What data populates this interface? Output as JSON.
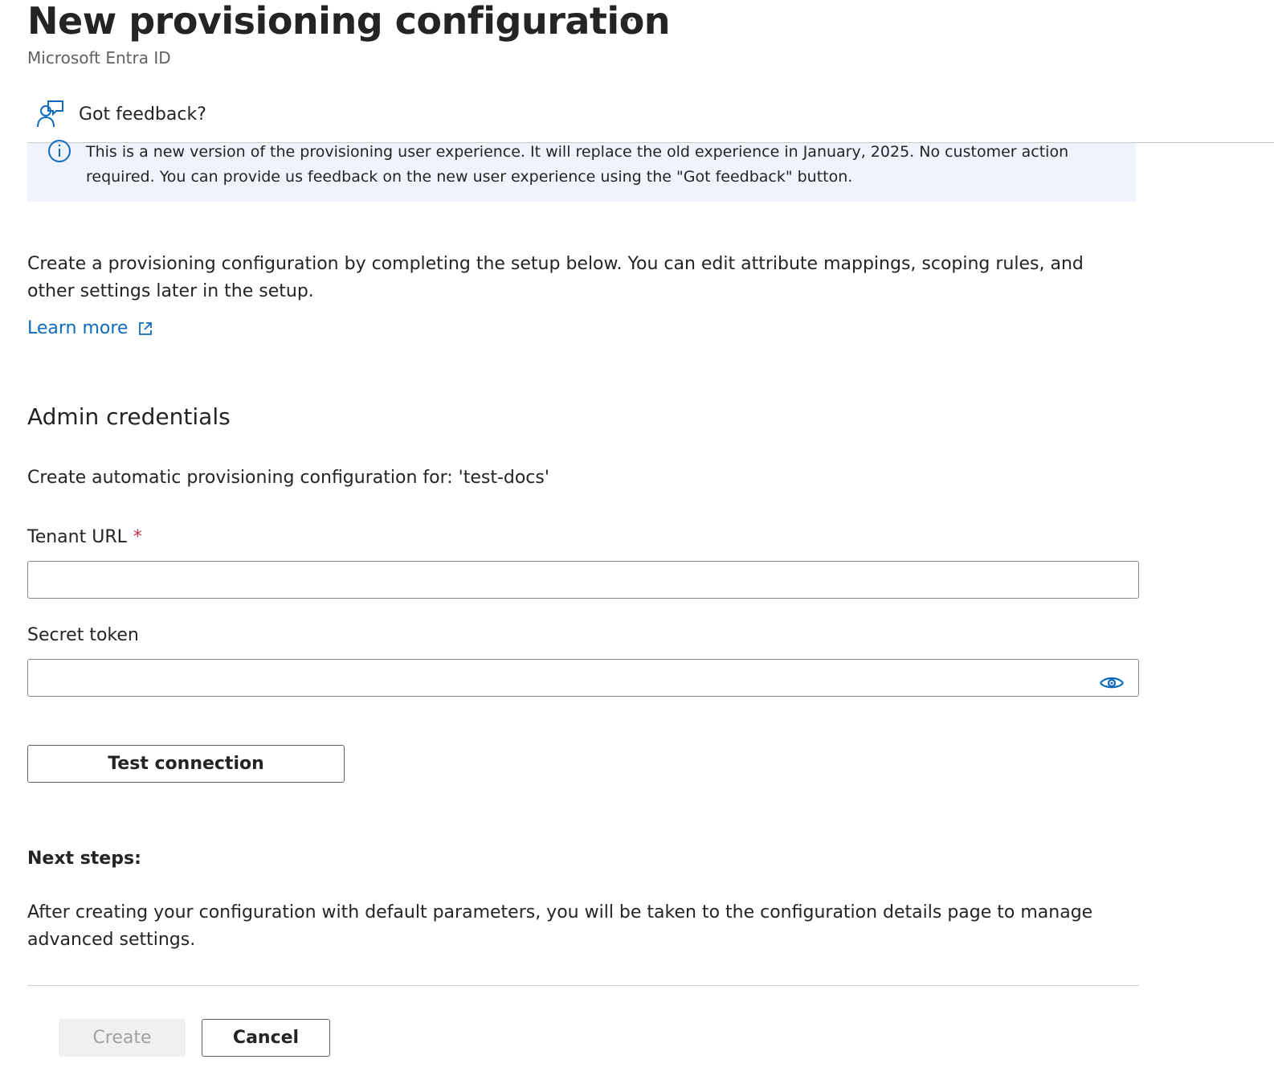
{
  "header": {
    "title": "New provisioning configuration",
    "more_label": "···",
    "subtitle": "Microsoft Entra ID"
  },
  "toolbar": {
    "feedback_label": "Got feedback?",
    "feedback_icon": "person-feedback-icon"
  },
  "banner": {
    "icon": "info-icon",
    "text": "This is a new version of the provisioning user experience. It will replace the old experience in January, 2025. No customer action required. You can provide us feedback on the new user experience using the \"Got feedback\" button."
  },
  "intro": {
    "text": "Create a provisioning configuration by completing the setup below. You can edit attribute mappings, scoping rules, and other settings later in the setup.",
    "learn_more_label": "Learn more",
    "learn_more_icon": "external-link-icon"
  },
  "admin": {
    "heading": "Admin credentials",
    "create_for_text": "Create automatic provisioning configuration for: 'test-docs'",
    "tenant_url_label": "Tenant URL",
    "required_marker": "*",
    "tenant_url_value": "",
    "secret_token_label": "Secret token",
    "secret_token_value": "",
    "reveal_icon": "eye-icon",
    "test_connection_label": "Test connection"
  },
  "next_steps": {
    "heading": "Next steps:",
    "text": "After creating your configuration with default parameters, you will be taken to the configuration details page to manage advanced settings."
  },
  "footer": {
    "create_label": "Create",
    "create_disabled": true,
    "cancel_label": "Cancel"
  },
  "colors": {
    "link": "#0f6cbd",
    "banner_bg": "#eff4fc",
    "required": "#c4314b",
    "text": "#242424"
  }
}
